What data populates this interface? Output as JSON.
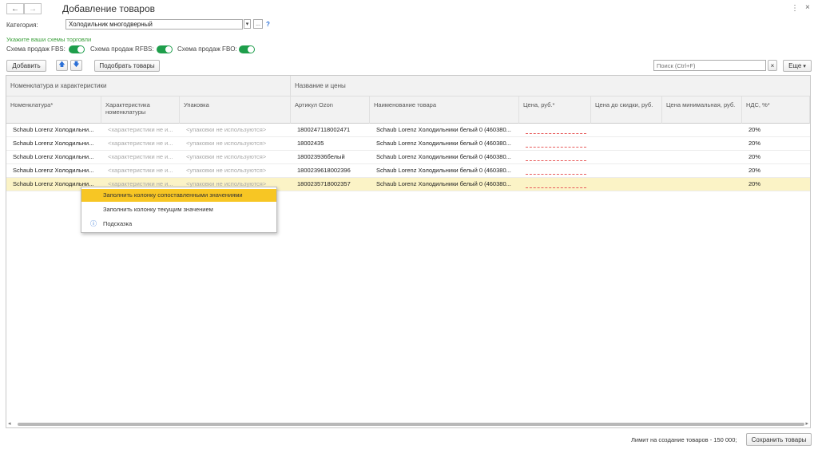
{
  "header": {
    "back_icon": "←",
    "forward_icon": "→",
    "title": "Добавление товаров",
    "more_icon": "⋮",
    "close_icon": "×"
  },
  "form": {
    "category_label": "Категория:",
    "category_value": "Холодильник многодверный",
    "dropdown_icon": "▾",
    "ellipsis_icon": "...",
    "help_icon": "?",
    "schemes_hint": "Укажите ваши схемы торговли",
    "fbs_label": "Схема продаж FBS:",
    "rfbs_label": "Схема продаж RFBS:",
    "fbo_label": "Схема продаж FBO:",
    "fbs_on": true,
    "rfbs_on": true,
    "fbo_on": true,
    "toggle_color": "#1e9e4b"
  },
  "toolbar": {
    "add_label": "Добавить",
    "up_icon": "🡅",
    "down_icon": "🡇",
    "pick_label": "Подобрать товары",
    "search_placeholder": "Поиск (Ctrl+F)",
    "clear_icon": "×",
    "more_label": "Еще",
    "more_arrow": "▾"
  },
  "table": {
    "group_left": "Номенклатура и характеристики",
    "group_right": "Название и цены",
    "columns": [
      "Номенклатура*",
      "Характеристика номенклатуры",
      "Упаковка",
      "Артикул Ozon",
      "Наименование товара",
      "Цена, руб.*",
      "Цена до скидки, руб.",
      "Цена минимальная, руб.",
      "НДС, %*"
    ],
    "rows": [
      {
        "nom": "Schaub Lorenz Холодильни...",
        "char": "<характеристики не и...",
        "pack": "<упаковки не используются>",
        "sku": "1800247118002471",
        "name": "Schaub Lorenz Холодильники белый 0 (460380...",
        "vat": "20%"
      },
      {
        "nom": "Schaub Lorenz Холодильни...",
        "char": "<характеристики не и...",
        "pack": "<упаковки не используются>",
        "sku": "18002435",
        "name": "Schaub Lorenz Холодильники белый 0 (460380...",
        "vat": "20%"
      },
      {
        "nom": "Schaub Lorenz Холодильни...",
        "char": "<характеристики не и...",
        "pack": "<упаковки не используются>",
        "sku": "180023936белый",
        "name": "Schaub Lorenz Холодильники белый 0 (460380...",
        "vat": "20%"
      },
      {
        "nom": "Schaub Lorenz Холодильни...",
        "char": "<характеристики не и...",
        "pack": "<упаковки не используются>",
        "sku": "1800239618002396",
        "name": "Schaub Lorenz Холодильники белый 0 (460380...",
        "vat": "20%"
      },
      {
        "nom": "Schaub Lorenz Холодильни...",
        "char": "<характеристики не и...",
        "pack": "<упаковки не используются>",
        "sku": "1800235718002357",
        "name": "Schaub Lorenz Холодильники белый 0 (460380...",
        "vat": "20%"
      }
    ],
    "selected_row_index": 4
  },
  "context_menu": {
    "items": [
      "Заполнить колонку сопоставленными значениями",
      "Заполнить колонку текущим значением",
      "Подсказка"
    ],
    "active_index": 0,
    "info_icon": "ⓘ",
    "highlight_color": "#f7c624"
  },
  "scrollbar": {
    "left_arrow": "◂",
    "right_arrow": "▸"
  },
  "footer": {
    "limit_text": "Лимит на создание товаров - 150 000;",
    "save_label": "Сохранить товары"
  }
}
